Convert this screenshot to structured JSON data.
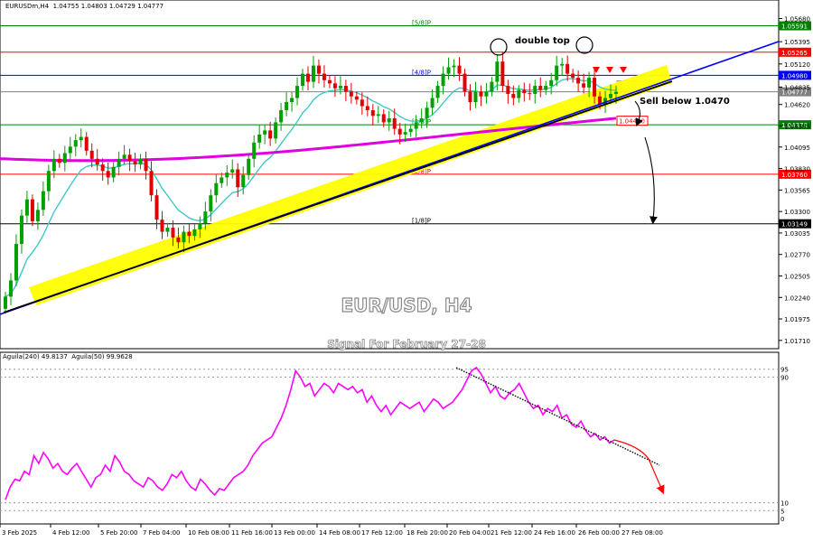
{
  "header": {
    "symbol_line": "EURUSDm,H4  1.04755 1.04803 1.04729 1.04777",
    "indicator_line": "Aguila(240) 49.8137  Aguila(50) 99.9628"
  },
  "chart_data": [
    {
      "type": "candlestick",
      "title": "EUR/USD, H4",
      "subtitle": "Signal For February  27-28",
      "ylim": [
        1.0163,
        1.0582
      ],
      "y_ticks": [
        "1.05680",
        "1.05395",
        "1.05120",
        "1.04835",
        "1.04620",
        "1.04355",
        "1.04095",
        "1.03830",
        "1.03565",
        "1.03300",
        "1.03035",
        "1.02770",
        "1.02505",
        "1.02240",
        "1.01975",
        "1.01710"
      ],
      "x_ticks": [
        "3 Feb 2025",
        "4 Feb 12:00",
        "5 Feb 20:00",
        "7 Feb 04:00",
        "10 Feb 08:00",
        "11 Feb 16:00",
        "13 Feb 00:00",
        "14 Feb 08:00",
        "17 Feb 12:00",
        "18 Feb 20:00",
        "20 Feb 04:00",
        "21 Feb 12:00",
        "24 Feb 16:00",
        "26 Feb 00:00",
        "27 Feb 08:00"
      ],
      "closes": [
        1.0225,
        1.0245,
        1.029,
        1.0325,
        1.0345,
        1.0318,
        1.0332,
        1.0355,
        1.038,
        1.0395,
        1.039,
        1.0402,
        1.041,
        1.0418,
        1.0422,
        1.0405,
        1.0395,
        1.0388,
        1.038,
        1.0372,
        1.0385,
        1.0395,
        1.04,
        1.0392,
        1.0388,
        1.0395,
        1.038,
        1.035,
        1.032,
        1.0305,
        1.031,
        1.0298,
        1.0292,
        1.0305,
        1.03,
        1.0308,
        1.0315,
        1.033,
        1.035,
        1.0365,
        1.0372,
        1.0378,
        1.0382,
        1.036,
        1.0375,
        1.0395,
        1.0415,
        1.0425,
        1.043,
        1.042,
        1.044,
        1.0455,
        1.0465,
        1.047,
        1.0485,
        1.05,
        1.049,
        1.051,
        1.05,
        1.0492,
        1.0488,
        1.0482,
        1.0485,
        1.0478,
        1.0472,
        1.0468,
        1.046,
        1.0455,
        1.0448,
        1.045,
        1.044,
        1.0445,
        1.0432,
        1.0425,
        1.0428,
        1.0432,
        1.044,
        1.0445,
        1.0458,
        1.047,
        1.0485,
        1.05,
        1.0508,
        1.051,
        1.05,
        1.0478,
        1.0465,
        1.0478,
        1.0472,
        1.0478,
        1.049,
        1.0515,
        1.0485,
        1.0475,
        1.047,
        1.048,
        1.0476,
        1.0475,
        1.0485,
        1.048,
        1.0485,
        1.0492,
        1.051,
        1.0512,
        1.05,
        1.0495,
        1.0488,
        1.0483,
        1.0495,
        1.0472,
        1.0462,
        1.047,
        1.0475,
        1.04777
      ],
      "levels": [
        {
          "label": "[5/8]P",
          "value": 1.05591,
          "tag": "1.05591",
          "color": "#008000"
        },
        {
          "label": "",
          "value": 1.05265,
          "tag": "1.05265",
          "color": "#ff0000"
        },
        {
          "label": "[4/8]P",
          "value": 1.0498,
          "tag": "1.04980",
          "color": "#0000ff"
        },
        {
          "label": "",
          "value": 1.04777,
          "tag": "1.04777",
          "color": "#808080"
        },
        {
          "label": "[3/8]P",
          "value": 1.0437,
          "tag": "1.04370",
          "color": "#008000"
        },
        {
          "label": "[2/8]P",
          "value": 1.0376,
          "tag": "1.03760",
          "color": "#ff0000"
        },
        {
          "label": "[1/8]P",
          "value": 1.03149,
          "tag": "1.03149",
          "color": "#000000"
        }
      ],
      "price_tags": [
        {
          "value": 1.04855,
          "tag": "1.04855",
          "color": "#ff8c00"
        },
        {
          "value": 1.0442,
          "tag": "1.04420",
          "color": "#ff0000"
        }
      ],
      "annotations": {
        "double_top": "double top",
        "sell": "Sell below 1.0470"
      },
      "colors": {
        "bull": "#00a000",
        "bear": "#e00000",
        "ema_fast": "#40c8c8",
        "ema_slow": "#e000e0",
        "channel": "#ffff00",
        "trendline_blue": "#0000ff"
      }
    },
    {
      "type": "line",
      "series_name": "Aguila(240)",
      "ylim": [
        0,
        100
      ],
      "y_ticks": [
        "95",
        "90",
        "10",
        "5",
        "0"
      ],
      "values": [
        12,
        20,
        25,
        24,
        30,
        28,
        40,
        35,
        42,
        38,
        32,
        35,
        30,
        28,
        32,
        35,
        30,
        25,
        20,
        26,
        28,
        34,
        30,
        40,
        36,
        30,
        28,
        24,
        22,
        20,
        26,
        24,
        20,
        18,
        22,
        28,
        26,
        30,
        24,
        20,
        18,
        25,
        22,
        18,
        15,
        19,
        18,
        22,
        26,
        28,
        30,
        34,
        40,
        44,
        48,
        50,
        52,
        58,
        64,
        72,
        82,
        94,
        90,
        84,
        86,
        78,
        82,
        86,
        84,
        80,
        86,
        84,
        82,
        84,
        80,
        82,
        74,
        78,
        72,
        68,
        72,
        66,
        70,
        74,
        72,
        70,
        72,
        74,
        68,
        72,
        76,
        74,
        70,
        72,
        74,
        78,
        82,
        88,
        94,
        96,
        92,
        86,
        80,
        84,
        78,
        76,
        80,
        82,
        86,
        80,
        74,
        70,
        72,
        66,
        70,
        68,
        72,
        64,
        66,
        60,
        58,
        62,
        56,
        52,
        54,
        50,
        52,
        48,
        50
      ],
      "extrapolation": [
        50,
        38,
        18
      ]
    }
  ]
}
